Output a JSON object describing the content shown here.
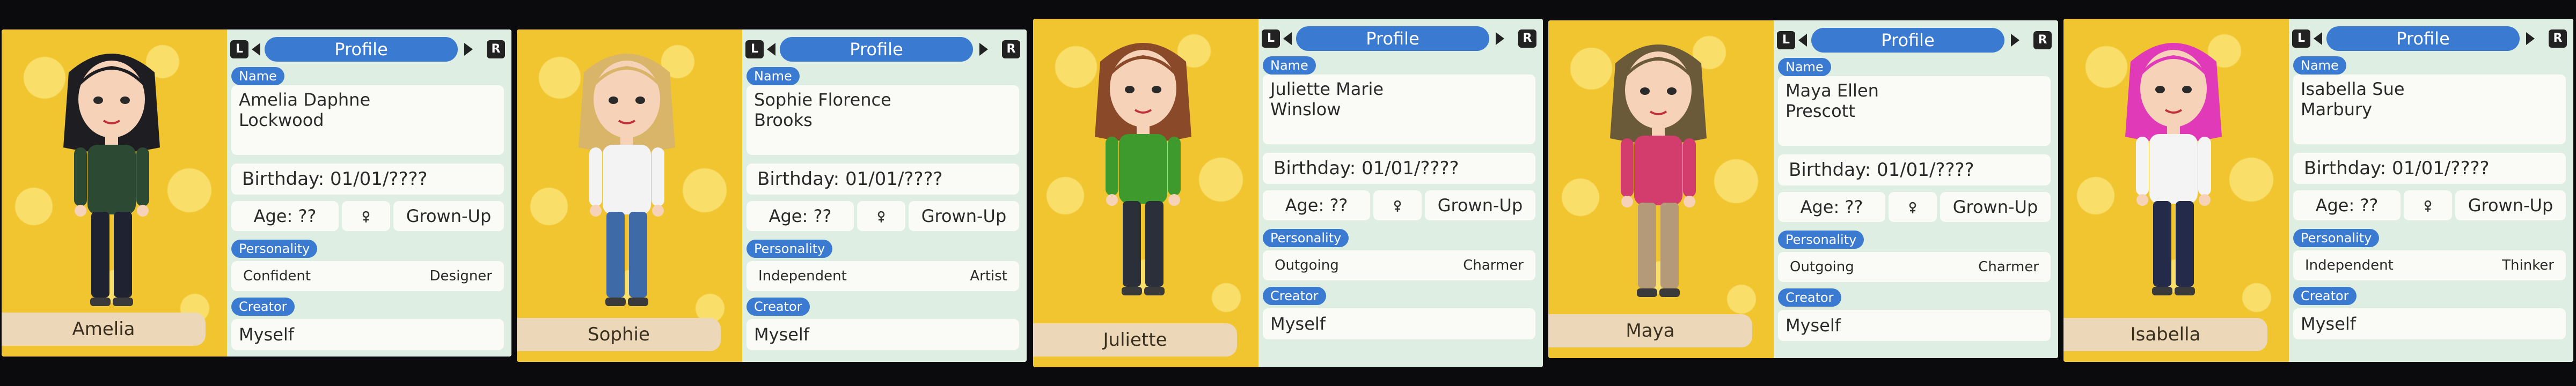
{
  "header_label": "Profile",
  "shoulder_left": "L",
  "shoulder_right": "R",
  "labels": {
    "name": "Name",
    "personality": "Personality",
    "creator": "Creator"
  },
  "colors": {
    "accent": "#3a7ad0",
    "panel": "#dfeee3",
    "background": "#f0c52f"
  },
  "profiles": [
    {
      "nickname": "Amelia",
      "name_line1": "Amelia Daphne",
      "name_line2": "Lockwood",
      "birthday": "Birthday: 01/01/????",
      "age": "Age: ??",
      "gender_icon": "female-symbol-icon",
      "life_stage": "Grown-Up",
      "personality_1": "Confident",
      "personality_2": "Designer",
      "creator": "Myself",
      "hair_color": "#1e1e22",
      "shirt_color": "#2c4a33",
      "pants_color": "#1f2230"
    },
    {
      "nickname": "Sophie",
      "name_line1": "Sophie Florence",
      "name_line2": "Brooks",
      "birthday": "Birthday: 01/01/????",
      "age": "Age: ??",
      "gender_icon": "female-symbol-icon",
      "life_stage": "Grown-Up",
      "personality_1": "Independent",
      "personality_2": "Artist",
      "creator": "Myself",
      "hair_color": "#d9b56a",
      "shirt_color": "#f3f3f3",
      "pants_color": "#3f6aa8"
    },
    {
      "nickname": "Juliette",
      "name_line1": "Juliette Marie",
      "name_line2": "Winslow",
      "birthday": "Birthday: 01/01/????",
      "age": "Age: ??",
      "gender_icon": "female-symbol-icon",
      "life_stage": "Grown-Up",
      "personality_1": "Outgoing",
      "personality_2": "Charmer",
      "creator": "Myself",
      "hair_color": "#8a4a2a",
      "shirt_color": "#3e9a2c",
      "pants_color": "#2a2f3a"
    },
    {
      "nickname": "Maya",
      "name_line1": "Maya Ellen",
      "name_line2": "Prescott",
      "birthday": "Birthday: 01/01/????",
      "age": "Age: ??",
      "gender_icon": "female-symbol-icon",
      "life_stage": "Grown-Up",
      "personality_1": "Outgoing",
      "personality_2": "Charmer",
      "creator": "Myself",
      "hair_color": "#6a5a3a",
      "shirt_color": "#d23d6e",
      "pants_color": "#b59a7a"
    },
    {
      "nickname": "Isabella",
      "name_line1": "Isabella Sue",
      "name_line2": "Marbury",
      "birthday": "Birthday: 01/01/????",
      "age": "Age: ??",
      "gender_icon": "female-symbol-icon",
      "life_stage": "Grown-Up",
      "personality_1": "Independent",
      "personality_2": "Thinker",
      "creator": "Myself",
      "hair_color": "#e03ab8",
      "shirt_color": "#f4f4f4",
      "pants_color": "#232a4a"
    }
  ]
}
